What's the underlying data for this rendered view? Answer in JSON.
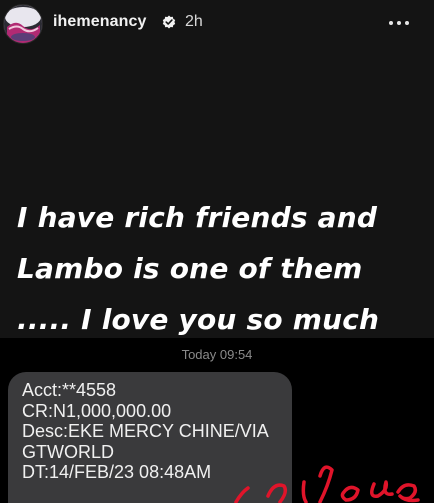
{
  "header": {
    "username": "ihemenancy",
    "time_ago": "2h",
    "avatar_icon": "profile-avatar",
    "verified_icon": "verified-badge-icon",
    "more_icon": "more-options-icon"
  },
  "caption": {
    "line1": "I have rich friends and",
    "line2": "Lambo is one of them",
    "line3": "..... I love you so much"
  },
  "message": {
    "timestamp": "Today 09:54",
    "lines": [
      "Acct:**4558",
      "CR:N1,000,000.00",
      "Desc:EKE MERCY CHINE/VIA",
      "GTWORLD",
      "DT:14/FEB/23 08:48AM"
    ]
  },
  "colors": {
    "background_top": "#141414",
    "background_bottom": "#000000",
    "bubble": "#3a3a3c",
    "sticker_red": "#e0142a"
  }
}
